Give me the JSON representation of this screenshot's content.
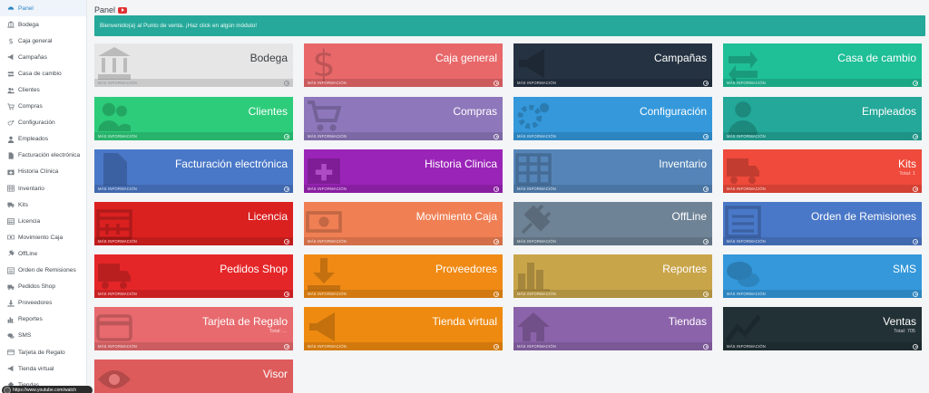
{
  "sidebar": {
    "items": [
      {
        "label": "Panel",
        "icon": "dashboard-icon"
      },
      {
        "label": "Bodega",
        "icon": "bank-icon"
      },
      {
        "label": "Caja general",
        "icon": "dollar-icon"
      },
      {
        "label": "Campañas",
        "icon": "bullhorn-icon"
      },
      {
        "label": "Casa de cambio",
        "icon": "exchange-icon"
      },
      {
        "label": "Clientes",
        "icon": "users-icon"
      },
      {
        "label": "Compras",
        "icon": "cart-icon"
      },
      {
        "label": "Configuración",
        "icon": "gears-icon"
      },
      {
        "label": "Empleados",
        "icon": "user-icon"
      },
      {
        "label": "Facturación electrónica",
        "icon": "file-icon"
      },
      {
        "label": "Historia Clínica",
        "icon": "medkit-icon"
      },
      {
        "label": "Inventario",
        "icon": "table-icon"
      },
      {
        "label": "Kits",
        "icon": "truck-icon"
      },
      {
        "label": "Licencia",
        "icon": "calendar-icon"
      },
      {
        "label": "Movimiento Caja",
        "icon": "money-icon"
      },
      {
        "label": "OffLine",
        "icon": "plug-icon"
      },
      {
        "label": "Orden de Remisiones",
        "icon": "list-icon"
      },
      {
        "label": "Pedidos Shop",
        "icon": "truck-icon"
      },
      {
        "label": "Proveedores",
        "icon": "download-icon"
      },
      {
        "label": "Reportes",
        "icon": "bar-chart-icon"
      },
      {
        "label": "SMS",
        "icon": "comments-icon"
      },
      {
        "label": "Tarjeta de Regalo",
        "icon": "credit-card-icon"
      },
      {
        "label": "Tienda virtual",
        "icon": "bullhorn-icon"
      },
      {
        "label": "Tiendas",
        "icon": "home-icon"
      }
    ]
  },
  "header": {
    "title": "Panel"
  },
  "banner": {
    "text": "Bienvenido(a) al Punto de venta. ¡Haz click en algún módulo!"
  },
  "tiles_footer": "MÁS INFORMACIÓN",
  "tiles": [
    {
      "title": "Bodega",
      "color": "#e6e6e6",
      "icon": "bank-icon",
      "light": true
    },
    {
      "title": "Caja general",
      "color": "#e8686a",
      "icon": "dollar-icon"
    },
    {
      "title": "Campañas",
      "color": "#253241",
      "icon": "bullhorn-icon"
    },
    {
      "title": "Casa de cambio",
      "color": "#1fbf97",
      "icon": "exchange-icon"
    },
    {
      "title": "Clientes",
      "color": "#2dcc7a",
      "icon": "users-icon"
    },
    {
      "title": "Compras",
      "color": "#8e77bb",
      "icon": "cart-icon"
    },
    {
      "title": "Configuración",
      "color": "#3498db",
      "icon": "gears-icon"
    },
    {
      "title": "Empleados",
      "color": "#23a899",
      "icon": "user-icon"
    },
    {
      "title": "Facturación electrónica",
      "color": "#4a78c8",
      "icon": "file-icon"
    },
    {
      "title": "Historia Clinica",
      "color": "#9b24b8",
      "icon": "medkit-icon"
    },
    {
      "title": "Inventario",
      "color": "#5585b8",
      "icon": "table-icon"
    },
    {
      "title": "Kits",
      "color": "#ef4a3b",
      "icon": "truck-icon",
      "sub": "Total: 1"
    },
    {
      "title": "Licencia",
      "color": "#db2020",
      "icon": "calendar-icon"
    },
    {
      "title": "Movimiento Caja",
      "color": "#f07f54",
      "icon": "money-icon"
    },
    {
      "title": "OffLine",
      "color": "#6f8396",
      "icon": "plug-icon"
    },
    {
      "title": "Orden de Remisiones",
      "color": "#4a78c8",
      "icon": "list-icon"
    },
    {
      "title": "Pedidos Shop",
      "color": "#e52628",
      "icon": "truck-icon"
    },
    {
      "title": "Proveedores",
      "color": "#f08a14",
      "icon": "download-icon"
    },
    {
      "title": "Reportes",
      "color": "#c9a54a",
      "icon": "bar-chart-icon"
    },
    {
      "title": "SMS",
      "color": "#3498db",
      "icon": "comments-icon"
    },
    {
      "title": "Tarjeta de Regalo",
      "color": "#e86a6e",
      "icon": "credit-card-icon",
      "sub": "Total: ..."
    },
    {
      "title": "Tienda virtual",
      "color": "#ef8a10",
      "icon": "bullhorn-icon"
    },
    {
      "title": "Tiendas",
      "color": "#8b63aa",
      "icon": "home-icon"
    },
    {
      "title": "Ventas",
      "color": "#223136",
      "icon": "chart-icon",
      "sub": "Total: 705"
    },
    {
      "title": "Visor",
      "color": "#de5b5b",
      "icon": "eye-icon"
    }
  ],
  "tooltip": {
    "text": "https://www.youtube.com/watch"
  }
}
